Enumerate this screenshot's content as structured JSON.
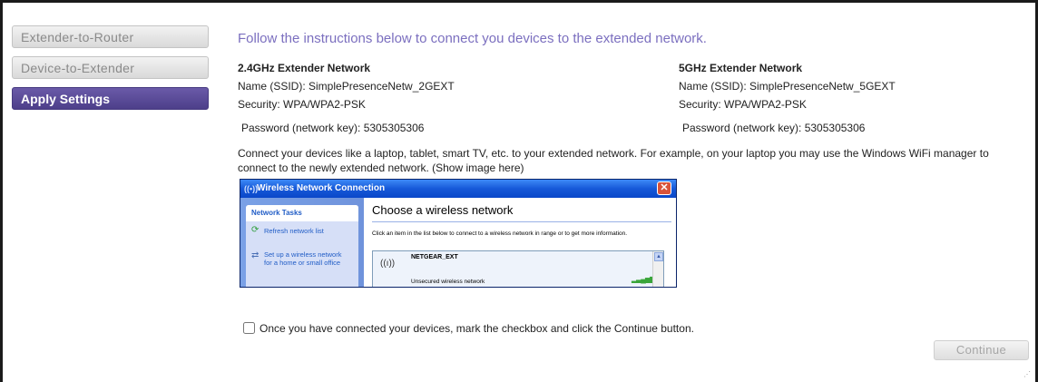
{
  "sidebar": {
    "items": [
      {
        "label": "Extender-to-Router",
        "active": false
      },
      {
        "label": "Device-to-Extender",
        "active": false
      },
      {
        "label": "Apply Settings",
        "active": true
      }
    ]
  },
  "main": {
    "heading": "Follow the instructions below to connect you devices to the extended network.",
    "network_24": {
      "title": "2.4GHz Extender Network",
      "ssid": "Name (SSID):  SimplePresenceNetw_2GEXT",
      "security": "Security: WPA/WPA2-PSK",
      "password": "Password (network key): 5305305306"
    },
    "network_5": {
      "title": "5GHz Extender Network",
      "ssid": "Name (SSID):  SimplePresenceNetw_5GEXT",
      "security": "Security: WPA/WPA2-PSK",
      "password": "Password (network key): 5305305306"
    },
    "instructions": "Connect your devices like a laptop, tablet, smart TV, etc. to your extended network. For example, on your laptop you may use the Windows WiFi manager to connect to the newly extended network. (Show image here)",
    "confirm_label": "Once you have connected your devices, mark the checkbox and click the Continue button.",
    "confirm_checked": false,
    "continue_label": "Continue",
    "continue_enabled": false
  },
  "xp_dialog": {
    "title": "Wireless Network Connection",
    "close_glyph": "✕",
    "tasks_header": "Network Tasks",
    "task_refresh": "Refresh network list",
    "task_setup_line1": "Set up a wireless network",
    "task_setup_line2": "for a home or small office",
    "heading": "Choose a wireless network",
    "description": "Click an item in the list below to connect to a wireless network in range or to get more information.",
    "network_name": "NETGEAR_EXT",
    "network_security": "Unsecured wireless network",
    "signal_level": 5,
    "signal_max": 5
  },
  "colors": {
    "accent": "#7b6fbf",
    "nav_active": "#4d3f8a",
    "xp_blue": "#1659d8"
  },
  "icons": {
    "refresh": "refresh-icon",
    "setup": "network-setup-icon",
    "antenna": "wireless-antenna-icon",
    "signal": "signal-strength-icon"
  }
}
